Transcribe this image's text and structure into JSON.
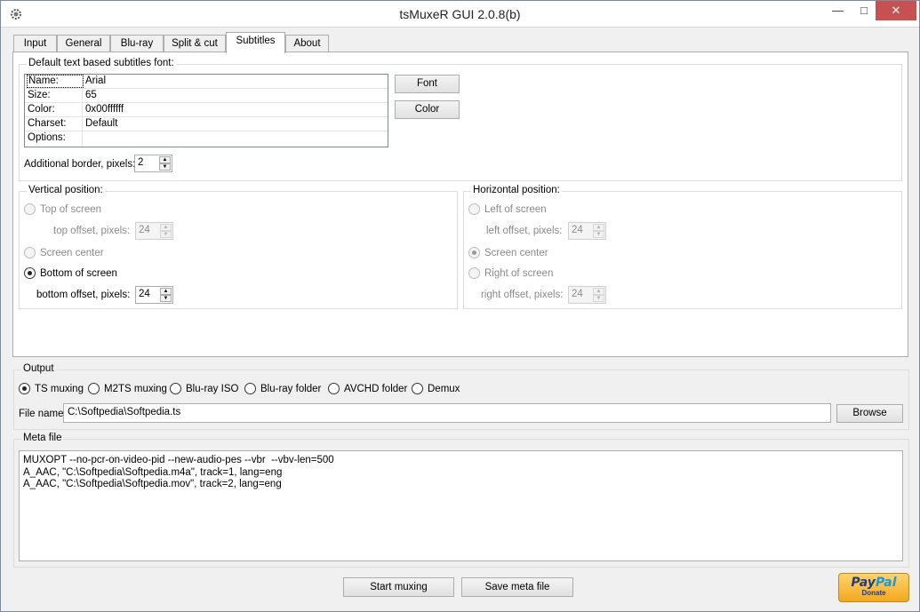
{
  "window": {
    "title": "tsMuxeR GUI 2.0.8(b)"
  },
  "tabs": [
    "Input",
    "General",
    "Blu-ray",
    "Split & cut",
    "Subtitles",
    "About"
  ],
  "subtitles": {
    "font_group_title": "Default text based subtitles font:",
    "properties": [
      {
        "name": "Name:",
        "value": "Arial"
      },
      {
        "name": "Size:",
        "value": "65"
      },
      {
        "name": "Color:",
        "value": "0x00ffffff"
      },
      {
        "name": "Charset:",
        "value": "Default"
      },
      {
        "name": "Options:",
        "value": ""
      }
    ],
    "font_button": "Font",
    "color_button": "Color",
    "border_label": "Additional border, pixels:",
    "border_value": "2",
    "vertical": {
      "title": "Vertical position:",
      "top_label": "Top of screen",
      "top_offset_label": "top offset, pixels:",
      "top_offset_value": "24",
      "center_label": "Screen center",
      "bottom_label": "Bottom of screen",
      "bottom_offset_label": "bottom offset, pixels:",
      "bottom_offset_value": "24"
    },
    "horizontal": {
      "title": "Horizontal position:",
      "left_label": "Left of screen",
      "left_offset_label": "left offset, pixels:",
      "left_offset_value": "24",
      "center_label": "Screen center",
      "right_label": "Right of screen",
      "right_offset_label": "right offset, pixels:",
      "right_offset_value": "24"
    }
  },
  "output": {
    "title": "Output",
    "options": [
      "TS muxing",
      "M2TS muxing",
      "Blu-ray ISO",
      "Blu-ray folder",
      "AVCHD folder",
      "Demux"
    ],
    "selected": "TS muxing",
    "file_label": "File name",
    "file_value": "C:\\Softpedia\\Softpedia.ts",
    "browse_button": "Browse"
  },
  "meta": {
    "title": "Meta file",
    "lines": [
      "MUXOPT --no-pcr-on-video-pid --new-audio-pes --vbr  --vbv-len=500",
      "A_AAC, \"C:\\Softpedia\\Softpedia.m4a\", track=1, lang=eng",
      "A_AAC, \"C:\\Softpedia\\Softpedia.mov\", track=2, lang=eng"
    ]
  },
  "actions": {
    "start": "Start muxing",
    "save_meta": "Save meta file"
  },
  "paypal": {
    "brand_a": "Pay",
    "brand_b": "Pal",
    "sub": "Donate"
  },
  "colors": {
    "close_button": "#c75050",
    "paypal_bg": "#f2a81e",
    "paypal_text": "#253b80"
  }
}
